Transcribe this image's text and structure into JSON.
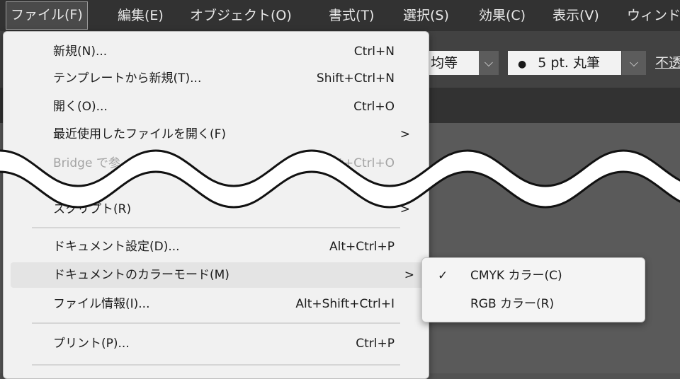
{
  "menubar": {
    "items": [
      "ファイル(F)",
      "編集(E)",
      "オブジェクト(O)",
      "書式(T)",
      "選択(S)",
      "効果(C)",
      "表示(V)",
      "ウィンド"
    ]
  },
  "controlbar": {
    "stroke_profile": "均等",
    "brush": "5 pt. 丸筆",
    "opacity_label": "不透"
  },
  "file_menu": {
    "items": [
      {
        "label": "新規(N)...",
        "shortcut": "Ctrl+N"
      },
      {
        "label": "テンプレートから新規(T)...",
        "shortcut": "Shift+Ctrl+N"
      },
      {
        "label": "開く(O)...",
        "shortcut": "Ctrl+O"
      },
      {
        "label": "最近使用したファイルを開く(F)",
        "shortcut": "",
        "submenu_arrow": ">"
      },
      {
        "label": "Bridge で参",
        "shortcut": "lt+Ctrl+O"
      },
      {
        "label": "スクリプト(R)",
        "shortcut": "",
        "submenu_arrow": ">"
      },
      {
        "label": "ドキュメント設定(D)...",
        "shortcut": "Alt+Ctrl+P"
      },
      {
        "label": "ドキュメントのカラーモード(M)",
        "shortcut": "",
        "submenu_arrow": ">"
      },
      {
        "label": "ファイル情報(I)...",
        "shortcut": "Alt+Shift+Ctrl+I"
      },
      {
        "label": "プリント(P)...",
        "shortcut": "Ctrl+P"
      }
    ]
  },
  "color_mode_submenu": {
    "items": [
      {
        "label": "CMYK カラー(C)",
        "check": "✓"
      },
      {
        "label": "RGB カラー(R)",
        "check": ""
      }
    ]
  },
  "colors": {
    "menubar_bg": "#323232",
    "menu_bg": "#f1f1f1",
    "hover_bg": "#e4e4e4",
    "disabled_text": "#a4a4a4"
  }
}
